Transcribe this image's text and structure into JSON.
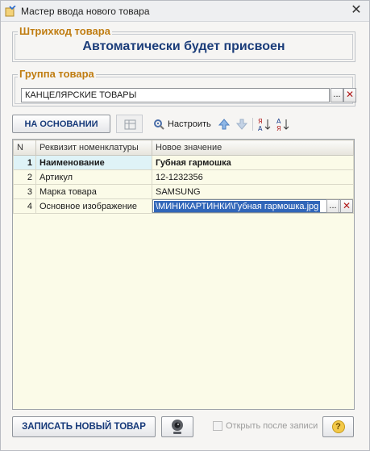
{
  "window": {
    "title": "Мастер ввода нового товара"
  },
  "barcode": {
    "title": "Штрихкод товара",
    "value": "Автоматически будет присвоен"
  },
  "product_group": {
    "title": "Группа товара",
    "value": "КАНЦЕЛЯРСКИЕ ТОВАРЫ",
    "ellipsis": "...",
    "clear": "✕"
  },
  "toolbar": {
    "based_on_label": "НА ОСНОВАНИИ",
    "configure_label": "Настроить"
  },
  "table": {
    "columns": [
      "N",
      "Реквизит номенклатуры",
      "Новое значение"
    ],
    "rows": [
      {
        "n": "1",
        "attr": "Наименование",
        "value": "Губная гармошка"
      },
      {
        "n": "2",
        "attr": "Артикул",
        "value": "12-1232356"
      },
      {
        "n": "3",
        "attr": "Марка товара",
        "value": "SAMSUNG"
      },
      {
        "n": "4",
        "attr": "Основное изображение",
        "value": "\\МИНИКАРТИНКИ\\Губная гармошка.jpg",
        "ellipsis": "...",
        "clear": "✕"
      }
    ]
  },
  "footer": {
    "save_label": "ЗАПИСАТЬ НОВЫЙ ТОВАР",
    "open_after_label": "Открыть после записи",
    "help_label": "?"
  },
  "colors": {
    "group_title": "#c07d12",
    "accent_text": "#173a7a",
    "selection": "#3166b9"
  },
  "icons": [
    "wizard-icon",
    "close-icon",
    "table-icon",
    "configure-icon",
    "arrow-up-icon",
    "arrow-down-icon",
    "sort-asc-icon",
    "sort-desc-icon",
    "webcam-icon",
    "help-icon"
  ]
}
